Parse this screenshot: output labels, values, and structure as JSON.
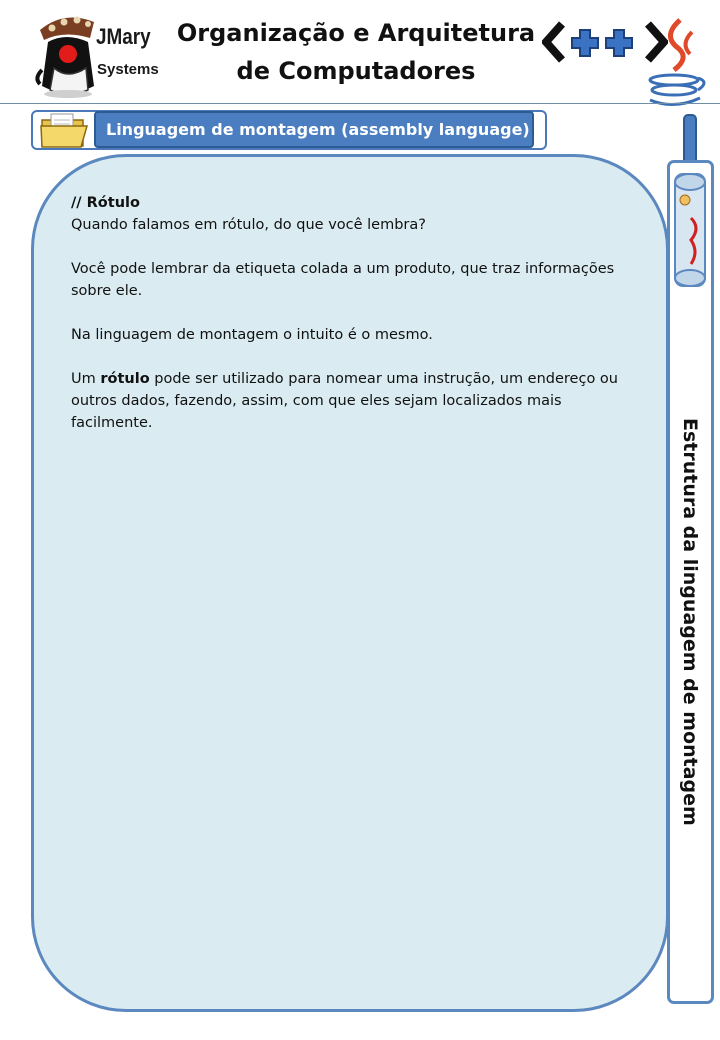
{
  "header": {
    "brand_name": "JMary",
    "brand_sub": "Systems",
    "title_line1": "Organização e Arquitetura",
    "title_line2": "de Computadores"
  },
  "section": {
    "title": "Linguagem de montagem (assembly language)"
  },
  "content": {
    "heading": "// Rótulo",
    "question": "Quando falamos em rótulo, do que você lembra?",
    "para1": "Você pode lembrar da etiqueta colada a um produto, que traz informações sobre ele.",
    "para2": "Na linguagem de montagem o intuito é o mesmo.",
    "para3_prefix": "Um ",
    "para3_bold": "rótulo",
    "para3_suffix": " pode ser utilizado para nomear uma instrução, um endereço ou outros dados, fazendo, assim, com que eles sejam localizados mais facilmente."
  },
  "sidebar": {
    "label": "Estrutura da linguagem de montagem"
  },
  "colors": {
    "accent_blue": "#4a7ec0",
    "card_background": "#daecf2",
    "card_border": "#5b88bf"
  },
  "icons": [
    "duke-mascot-logo",
    "cpp-logo",
    "java-logo",
    "folder-icon",
    "scroll-icon"
  ]
}
